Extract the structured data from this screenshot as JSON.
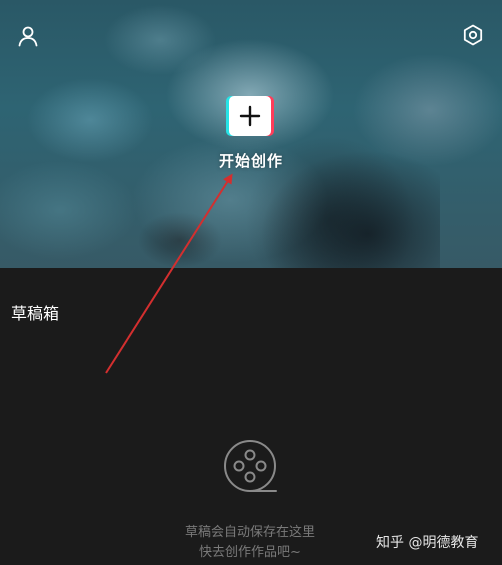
{
  "header": {
    "profile_icon": "user-icon",
    "settings_icon": "settings-gear-icon"
  },
  "create": {
    "icon": "plus-icon",
    "label": "开始创作"
  },
  "drafts": {
    "title": "草稿箱",
    "empty_icon": "film-reel-icon",
    "empty_line1": "草稿会自动保存在这里",
    "empty_line2": "快去创作作品吧~"
  },
  "watermark": {
    "text": "知乎 @明德教育"
  },
  "colors": {
    "annotation_arrow": "#d32f2f",
    "plus_shadow_cyan": "#27e3e6",
    "plus_shadow_red": "#ff3d5a",
    "panel_background": "#1b1b1b"
  }
}
